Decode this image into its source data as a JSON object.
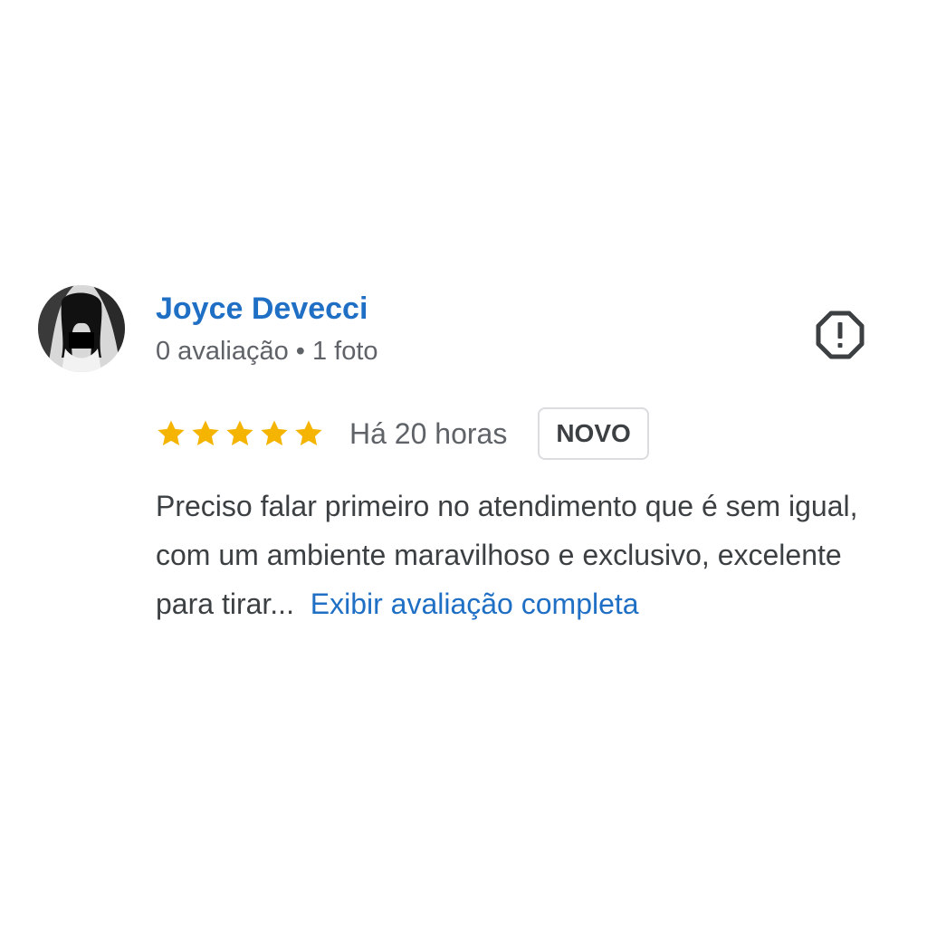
{
  "review": {
    "author_name": "Joyce Devecci",
    "author_meta": "0 avaliação • 1 foto",
    "avatar_icon": "user-avatar-photo",
    "report_icon": "report-flag-icon",
    "rating": 5,
    "rating_max": 5,
    "time_ago": "Há 20 horas",
    "badge": "NOVO",
    "text": "Preciso falar primeiro no atendimento que é sem igual, com um ambiente maravilhoso e exclusivo, excelente para tirar...",
    "more_link": "Exibir avaliação completa"
  },
  "colors": {
    "link_blue": "#1f6fc5",
    "star_gold": "#f4b400",
    "secondary_text": "#5f6368",
    "body_text": "#3c4043",
    "badge_border": "#dadce0"
  }
}
